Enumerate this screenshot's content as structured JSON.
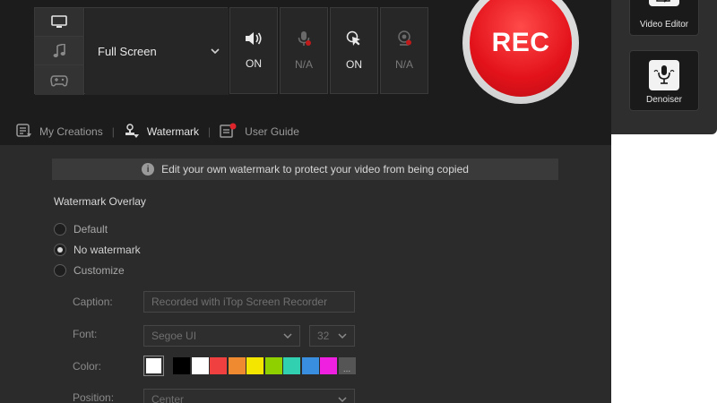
{
  "mode": {
    "selected": "Full Screen",
    "icons": [
      "monitor-icon",
      "music-icon",
      "gamepad-icon"
    ]
  },
  "toggles": [
    {
      "name": "speaker",
      "status": "ON"
    },
    {
      "name": "microphone",
      "status": "N/A"
    },
    {
      "name": "mouse",
      "status": "ON"
    },
    {
      "name": "webcam",
      "status": "N/A"
    }
  ],
  "rec_label": "REC",
  "side_tools": [
    {
      "label": "Video Editor"
    },
    {
      "label": "Denoiser"
    }
  ],
  "tabs": [
    {
      "label": "My Creations"
    },
    {
      "label": "Watermark"
    },
    {
      "label": "User Guide"
    }
  ],
  "info_text": "Edit your own watermark to protect your video from being copied",
  "section_title": "Watermark Overlay",
  "options": [
    {
      "label": "Default",
      "checked": false
    },
    {
      "label": "No watermark",
      "checked": true
    },
    {
      "label": "Customize",
      "checked": false
    }
  ],
  "fields": {
    "caption_label": "Caption:",
    "caption_value": "Recorded with iTop Screen Recorder",
    "font_label": "Font:",
    "font_value": "Segoe UI",
    "font_size": "32",
    "color_label": "Color:",
    "position_label": "Position:",
    "position_value": "Center"
  },
  "colors": {
    "current": "#ffffff",
    "palette": [
      "#000000",
      "#ffffff",
      "#f04040",
      "#f08a30",
      "#f5e600",
      "#8ed000",
      "#30d0b0",
      "#3a8ee0",
      "#f020e0"
    ],
    "more": "..."
  }
}
